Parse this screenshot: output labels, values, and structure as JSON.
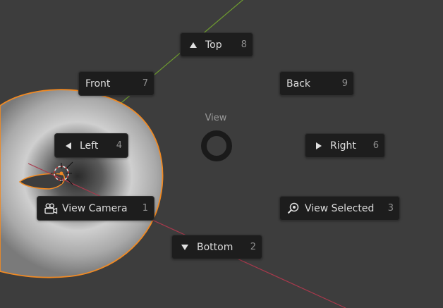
{
  "pie_menu": {
    "title": "View",
    "items": {
      "top": {
        "label": "Top",
        "key": "8",
        "icon": "triangle-up-icon"
      },
      "front": {
        "label": "Front",
        "key": "7",
        "icon": ""
      },
      "back": {
        "label": "Back",
        "key": "9",
        "icon": ""
      },
      "left": {
        "label": "Left",
        "key": "4",
        "icon": "triangle-left-icon"
      },
      "right": {
        "label": "Right",
        "key": "6",
        "icon": "triangle-right-icon"
      },
      "camera": {
        "label": "View Camera",
        "key": "1",
        "icon": "camera-icon"
      },
      "selected": {
        "label": "View Selected",
        "key": "3",
        "icon": "zoom-selected-icon"
      },
      "bottom": {
        "label": "Bottom",
        "key": "2",
        "icon": "triangle-down-icon"
      }
    }
  },
  "colors": {
    "viewport_bg": "#3d3d3d",
    "menu_item_bg": "#1d1d1d",
    "menu_text": "#dcdcdc",
    "shortcut_text": "#8f8f8f",
    "selection_outline": "#f08a24",
    "y_axis": "#6f9d2f",
    "x_axis": "#a8394c"
  }
}
